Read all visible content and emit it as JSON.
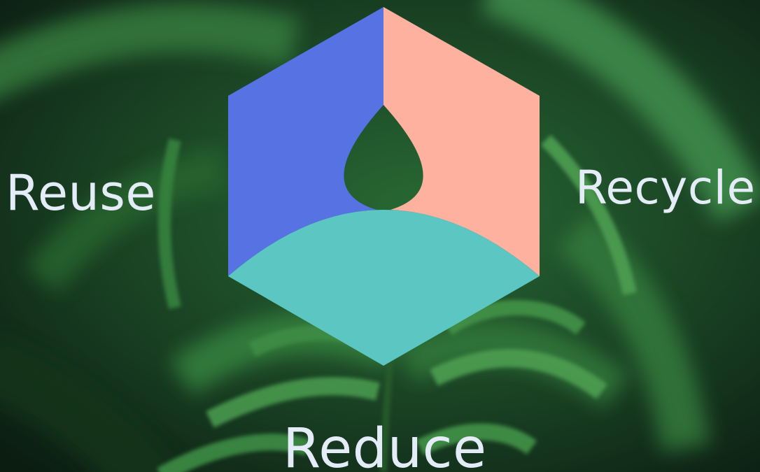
{
  "labels": {
    "reuse": "Reuse",
    "recycle": "Recycle",
    "reduce": "Reduce"
  },
  "colors": {
    "reuse_face": "#5672e3",
    "recycle_face": "#ffb19f",
    "reduce_face": "#5cc6c2",
    "label_text": "#e4ecf7"
  },
  "background": {
    "subject": "fern leaves photo",
    "tones": [
      "#0f2416",
      "#1f5a2c",
      "#3f9a4a",
      "#6fbf68"
    ]
  },
  "icons": [
    "hexagon-cube-icon"
  ]
}
